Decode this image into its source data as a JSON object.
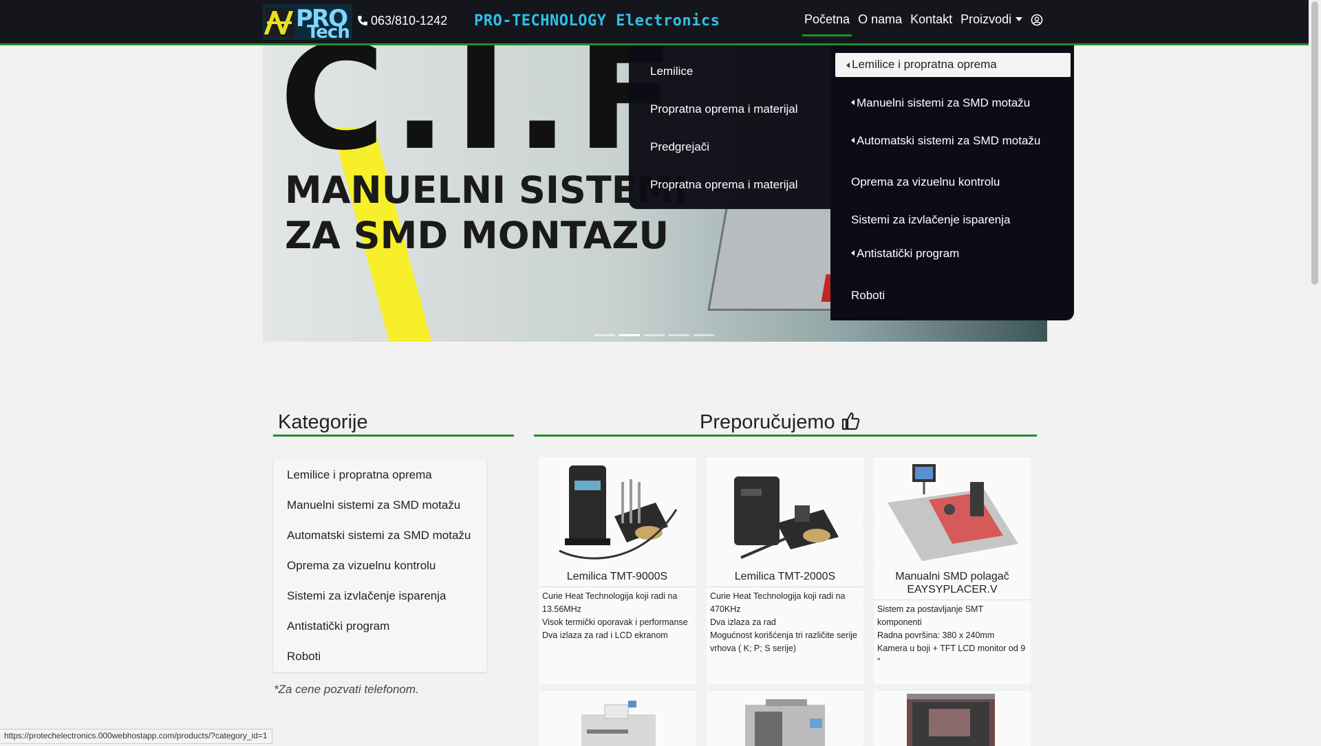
{
  "navbar": {
    "logo_text_top": "PRO",
    "logo_text_bottom": "Tech",
    "phone": "063/810-1242",
    "brand": "PRO-TECHNOLOGY Electronics",
    "links": [
      "Početna",
      "O nama",
      "Kontakt",
      "Proizvodi"
    ],
    "icons": {
      "phone": "phone-icon",
      "user": "user-circle-icon"
    }
  },
  "carousel": {
    "big_text": "C.I.F",
    "headline_line1": "MANUELNI SISTEMI",
    "headline_line2": "ZA SMD MONTAZU",
    "slide_count": 5,
    "active_slide": 2
  },
  "submenu": {
    "items": [
      "Lemilice",
      "Propratna oprema i materijal",
      "Predgrejači",
      "Propratna oprema i materijal"
    ]
  },
  "mainmenu": {
    "items": [
      {
        "label": "Lemilice i propratna oprema",
        "has_sub": true
      },
      {
        "label": "Manuelni sistemi za SMD motažu",
        "has_sub": true
      },
      {
        "label": "Automatski sistemi za SMD motažu",
        "has_sub": true
      },
      {
        "label": "Oprema za vizuelnu kontrolu",
        "has_sub": false
      },
      {
        "label": "Sistemi za izvlačenje isparenja",
        "has_sub": false
      },
      {
        "label": "Antistatički program",
        "has_sub": true
      },
      {
        "label": "Roboti",
        "has_sub": false
      }
    ]
  },
  "categories": {
    "heading": "Kategorije",
    "items": [
      "Lemilice i propratna oprema",
      "Manuelni sistemi za SMD motažu",
      "Automatski sistemi za SMD motažu",
      "Oprema za vizuelnu kontrolu",
      "Sistemi za izvlačenje isparenja",
      "Antistatički program",
      "Roboti"
    ],
    "note": "*Za cene pozvati telefonom."
  },
  "recommended": {
    "heading": "Preporučujemo",
    "icon": "thumbs-up-icon",
    "products": [
      {
        "title": "Lemilica TMT-9000S",
        "desc": [
          "Curie Heat Technologija koji radi na 13.56MHz",
          "Visok termički oporavak i performanse",
          "Dva izlaza za rad i LCD ekranom"
        ]
      },
      {
        "title": "Lemilica TMT-2000S",
        "desc": [
          "Curie Heat Technologija koji radi na 470KHz",
          "Dva izlaza za rad",
          "Mogućnost korišćenja tri različite serije vrhova ( K; P; S serije)"
        ]
      },
      {
        "title": "Manualni SMD polagač EAYSYPLACER.V",
        "desc": [
          "Sistem za postavljanje SMT komponenti",
          "Radna površina: 380 x 240mm",
          "Kamera u boji + TFT LCD monitor od 9 \""
        ]
      }
    ]
  },
  "status_bar": "https://protechelectronics.000webhostapp.com/products/?category_id=1",
  "colors": {
    "accent_green": "#1f8f2e",
    "navbar_bg": "#15161b",
    "brand_cyan": "#2ec0e6",
    "menu_bg": "#0c0c17"
  }
}
